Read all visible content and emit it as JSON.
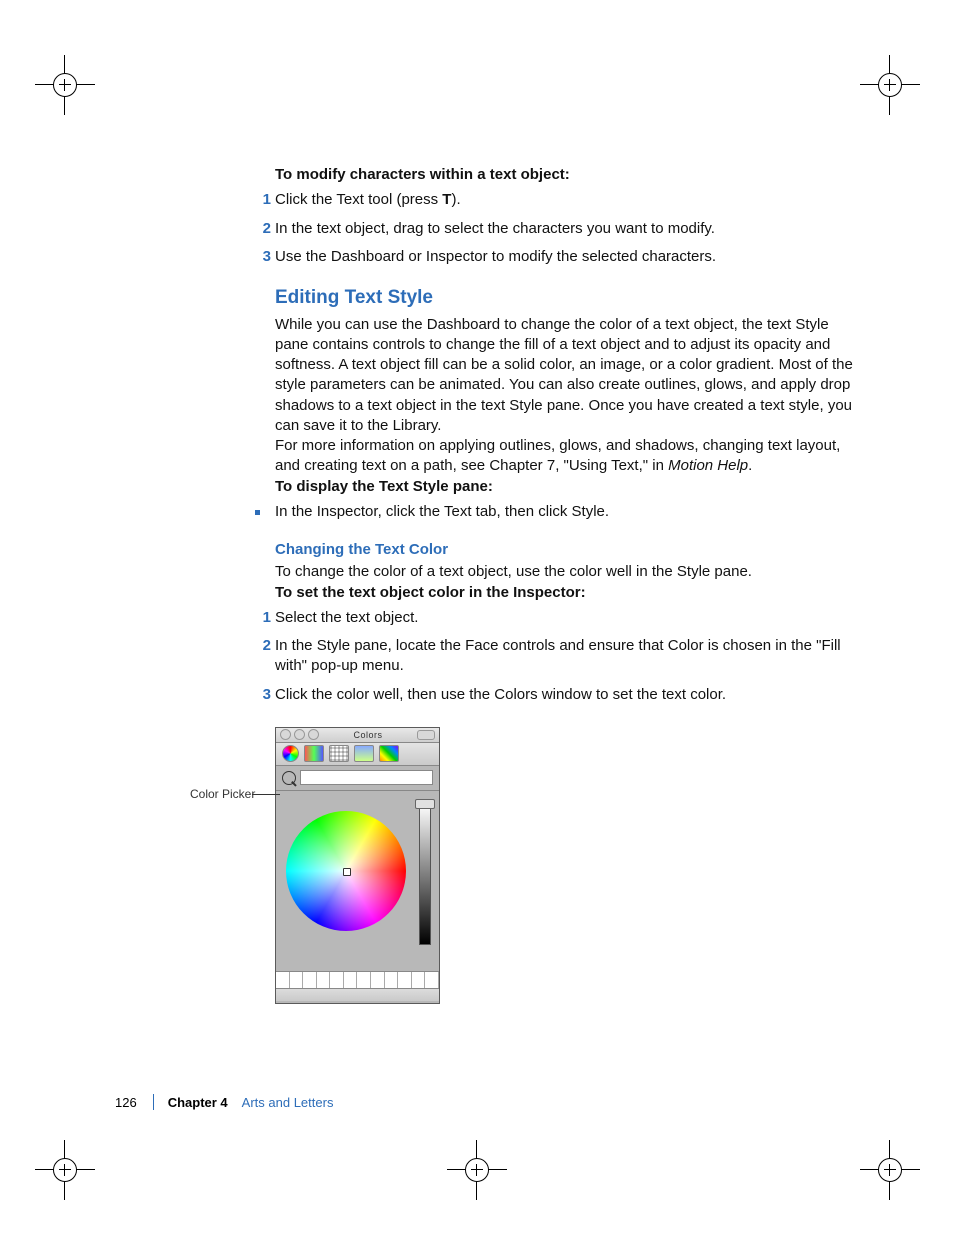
{
  "footer": {
    "page_number": "126",
    "chapter_label": "Chapter 4",
    "chapter_title": "Arts and Letters"
  },
  "section1": {
    "intro": "To modify characters within a text object:",
    "steps": [
      {
        "n": "1",
        "pre": "Click the Text tool (press ",
        "key": "T",
        "post": ")."
      },
      {
        "n": "2",
        "text": "In the text object, drag to select the characters you want to modify."
      },
      {
        "n": "3",
        "text": "Use the Dashboard or Inspector to modify the selected characters."
      }
    ]
  },
  "section2": {
    "heading": "Editing Text Style",
    "para1": "While you can use the Dashboard to change the color of a text object, the text Style pane contains controls to change the fill of a text object and to adjust its opacity and softness. A text object fill can be a solid color, an image, or a color gradient. Most of the style parameters can be animated. You can also create outlines, glows, and apply drop shadows to a text object in the text Style pane. Once you have created a text style, you can save it to the Library.",
    "para2_pre": "For more information on applying outlines, glows, and shadows, changing text layout, and creating text on a path, see Chapter 7, \"Using Text,\" in ",
    "para2_italic": "Motion Help",
    "para2_post": "."
  },
  "section3": {
    "intro": "To display the Text Style pane:",
    "bullet": "In the Inspector, click the Text tab, then click Style."
  },
  "section4": {
    "heading": "Changing the Text Color",
    "para": "To change the color of a text object, use the color well in the Style pane."
  },
  "section5": {
    "intro": "To set the text object color in the Inspector:",
    "steps": [
      {
        "n": "1",
        "text": "Select the text object."
      },
      {
        "n": "2",
        "text": "In the Style pane, locate the Face controls and ensure that Color is chosen in the \"Fill with\" pop-up menu."
      },
      {
        "n": "3",
        "text": "Click the color well, then use the Colors window to set the text color."
      }
    ]
  },
  "figure": {
    "callout_label": "Color Picker",
    "window_title": "Colors"
  }
}
